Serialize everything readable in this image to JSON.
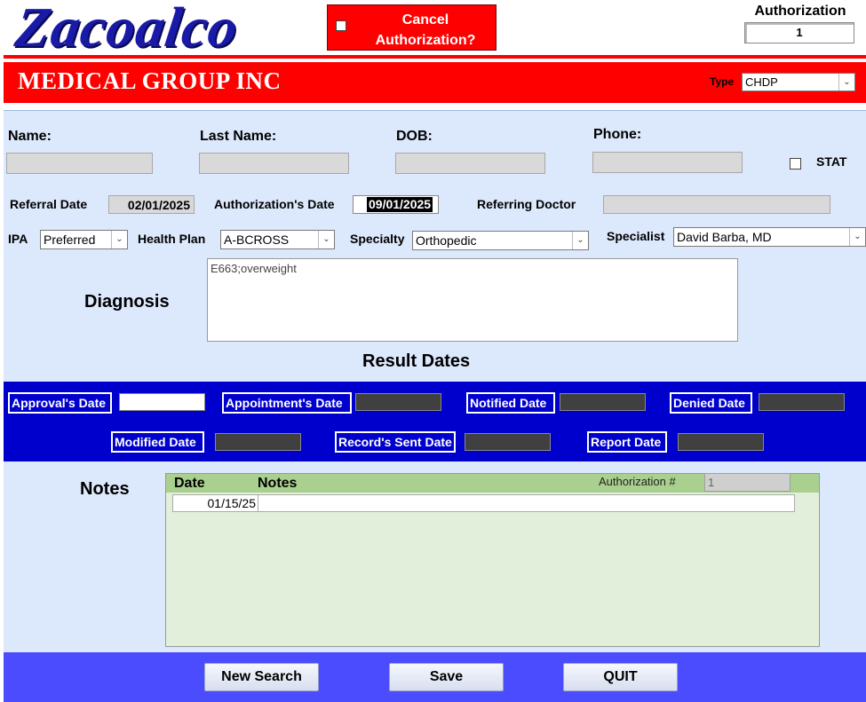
{
  "header": {
    "logo_text": "Zacoalco",
    "company_band": "MEDICAL GROUP INC",
    "cancel_label_line1": "Cancel",
    "cancel_label_line2": "Authorization?",
    "auth_title": "Authorization",
    "auth_number": "1",
    "type_label": "Type",
    "type_value": "CHDP"
  },
  "patient": {
    "name_label": "Name:",
    "last_name_label": "Last Name:",
    "dob_label": "DOB:",
    "phone_label": "Phone:",
    "stat_label": "STAT"
  },
  "referral": {
    "referral_date_label": "Referral Date",
    "referral_date": "02/01/2025",
    "auth_date_label": "Authorization's Date",
    "auth_date": "09/01/2025",
    "referring_doctor_label": "Referring Doctor"
  },
  "plan": {
    "ipa_label": "IPA",
    "ipa_value": "Preferred",
    "health_plan_label": "Health Plan",
    "health_plan_value": "A-BCROSS",
    "specialty_label": "Specialty",
    "specialty_value": "Orthopedic",
    "specialist_label": "Specialist",
    "specialist_value": "David Barba, MD"
  },
  "diagnosis": {
    "label": "Diagnosis",
    "text": "E663;overweight"
  },
  "result_dates": {
    "heading": "Result Dates",
    "approvals_label": "Approval's Date",
    "appointments_label": "Appointment's Date",
    "notified_label": "Notified Date",
    "denied_label": "Denied Date",
    "modified_label": "Modified Date",
    "records_sent_label": "Record's Sent Date",
    "report_label": "Report Date"
  },
  "notes": {
    "label": "Notes",
    "col_date": "Date",
    "col_notes": "Notes",
    "auth_num_label": "Authorization #",
    "auth_num_value": "1",
    "rows": [
      {
        "date": "01/15/25",
        "note": ""
      }
    ]
  },
  "buttons": {
    "new_search": "New Search",
    "save": "Save",
    "quit": "QUIT"
  },
  "colors": {
    "red": "#ff0000",
    "navy": "#0000cc",
    "form_bg": "#dce8fb",
    "bottom_band": "#4c4cff"
  }
}
